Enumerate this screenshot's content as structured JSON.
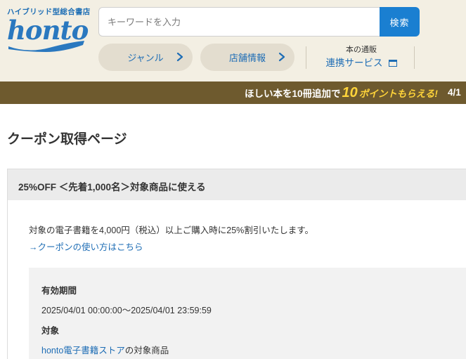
{
  "header": {
    "tagline": "ハイブリッド型総合書店",
    "logo_text": "honto",
    "search": {
      "placeholder": "キーワードを入力",
      "button_label": "検索"
    },
    "nav": {
      "genre_label": "ジャンル",
      "store_label": "店舗情報",
      "service_sub": "本の通販",
      "service_main": "連携サービス"
    },
    "colors": {
      "accent": "#1a7fd1",
      "header_bg": "#f3efe3",
      "banner_bg": "#6e5a2e",
      "banner_highlight": "#ffd43a"
    }
  },
  "banner": {
    "prefix": "ほしい本を10冊追加で",
    "points_number": "10",
    "points_suffix": "ポイントもらえる!",
    "date": "4/1"
  },
  "page": {
    "title": "クーポン取得ページ"
  },
  "coupon": {
    "heading": "25%OFF ＜先着1,000名＞対象商品に使える",
    "description": "対象の電子書籍を4,000円（税込）以上ご購入時に25%割引いたします。",
    "howto_link": "→クーポンの使い方はこちら",
    "validity_label": "有効期間",
    "validity_value": "2025/04/01 00:00:00～2025/04/01 23:59:59",
    "target_label": "対象",
    "target_link": "honto電子書籍ストア",
    "target_suffix": "の対象商品"
  },
  "icons": [
    "chevron-right-icon",
    "window-icon",
    "logo-swoosh-icon"
  ]
}
